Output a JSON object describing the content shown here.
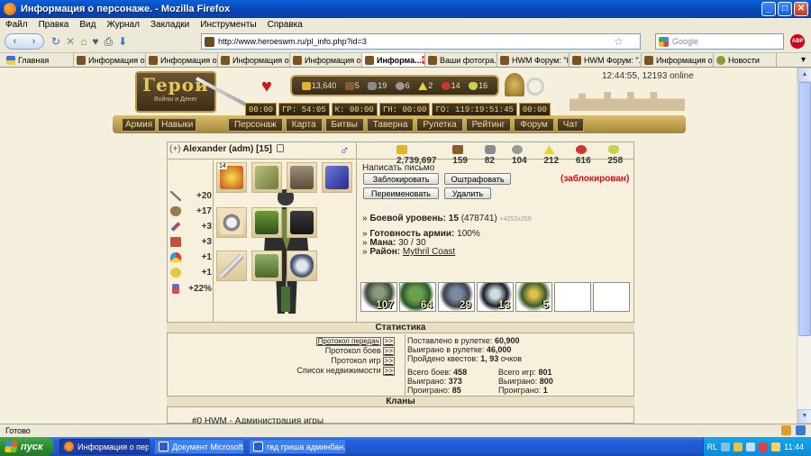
{
  "window": {
    "title": "Информация о персонаже. - Mozilla Firefox",
    "minimize": "_",
    "maximize": "□",
    "close": "✕"
  },
  "menu": [
    "Файл",
    "Правка",
    "Вид",
    "Журнал",
    "Закладки",
    "Инструменты",
    "Справка"
  ],
  "nav": {
    "back": "‹",
    "forward": "›",
    "reload": "↻",
    "stop": "✕",
    "home": "⌂",
    "url": "http://www.heroeswm.ru/pl_info.php?id=3",
    "search_placeholder": "Google",
    "abp": "ABP"
  },
  "tabs": [
    {
      "label": "Главная"
    },
    {
      "label": "Информация о ..."
    },
    {
      "label": "Информация о ..."
    },
    {
      "label": "Информация о ..."
    },
    {
      "label": "Информация о ..."
    },
    {
      "label": "Информа..."
    },
    {
      "label": "Ваши фотогра..."
    },
    {
      "label": "HWM Форум: \"I..."
    },
    {
      "label": "HWM Форум: \"..."
    },
    {
      "label": "Информация о ..."
    },
    {
      "label": "Новости"
    }
  ],
  "game": {
    "clock": "12:44:55, 12193 online",
    "logo_title": "Герои",
    "logo_sub": "Войны и Денег",
    "resources": {
      "gold": "13,640",
      "wood": "5",
      "ore": "19",
      "mercury": "6",
      "sulfur": "2",
      "crystal": "14",
      "gems": "16"
    },
    "timers": [
      "00:00",
      "ГР: 54:05",
      "К: 00:00",
      "ГН: 00:00",
      "ГО: 119:19:51:45",
      "00:00"
    ],
    "left_nav": [
      "Армия",
      "Навыки"
    ],
    "main_nav": [
      "Персонаж",
      "Карта",
      "Битвы",
      "Таверна",
      "Рулетка",
      "Рейтинг",
      "Форум",
      "Чат"
    ]
  },
  "player": {
    "plus": "(+)",
    "name": "Alexander (adm)",
    "level": "[15]",
    "gender_icon": "♂",
    "resources": {
      "gold": "2,739,697",
      "wood": "159",
      "ore": "82",
      "mercury": "104",
      "sulfur": "212",
      "crystal": "616",
      "gems": "258"
    },
    "stats": [
      {
        "name": "attack",
        "value": "+20"
      },
      {
        "name": "defense",
        "value": "+17"
      },
      {
        "name": "spellpower",
        "value": "+3"
      },
      {
        "name": "knowledge",
        "value": "+3"
      },
      {
        "name": "luck",
        "value": "+1"
      },
      {
        "name": "morale",
        "value": "+1"
      },
      {
        "name": "initiative",
        "value": "+22%"
      }
    ],
    "equip_level": "14",
    "write_letter": "Написать письмо",
    "buttons": {
      "block": "Заблокировать",
      "fine": "Оштрафовать",
      "rename": "Переименовать",
      "delete": "Удалить"
    },
    "blocked": "(заблокирован)",
    "combat_label": "Боевой уровень:",
    "combat_value": "15",
    "combat_exp": "(478741)",
    "combat_extra": "+4252±259",
    "army_label": "Готовность армии:",
    "army_value": "100%",
    "mana_label": "Мана:",
    "mana_value": "30 / 30",
    "district_label": "Район:",
    "district_value": "Mythril Coast",
    "army": [
      "107",
      "64",
      "29",
      "13",
      "5",
      "",
      ""
    ]
  },
  "stats_section": {
    "header": "Статистика",
    "links": [
      {
        "label": "Протокол передач",
        "btn": ">>"
      },
      {
        "label": "Протокол боев",
        "btn": ">>"
      },
      {
        "label": "Протокол игр",
        "btn": ">>"
      },
      {
        "label": "Список недвижимости",
        "btn": ">>"
      }
    ],
    "roulette_bet": "Поставлено в рулетке:",
    "roulette_bet_v": "60,900",
    "roulette_win": "Выиграно в рулетке:",
    "roulette_win_v": "46,000",
    "quests": "Пройдено квестов:",
    "quests_v": "1, 93",
    "quests_unit": "очков",
    "battles_total": "Всего боев:",
    "battles_total_v": "458",
    "battles_won": "Выиграно:",
    "battles_won_v": "373",
    "battles_lost": "Проиграно:",
    "battles_lost_v": "85",
    "games_total": "Всего игр:",
    "games_total_v": "801",
    "games_won": "Выиграно:",
    "games_won_v": "800",
    "games_lost": "Проиграно:",
    "games_lost_v": "1"
  },
  "clans": {
    "header": "Кланы",
    "entry": "#0 HWM - Администрация игры"
  },
  "statusbar": {
    "text": "Готово"
  },
  "taskbar": {
    "start": "пуск",
    "tasks": [
      "Информация о персо...",
      "Документ Microsoft ...",
      "гвд гриша админбан..."
    ],
    "lang": "RL",
    "time": "11:44"
  },
  "colors": {
    "blocked": "#c2141c",
    "accent_gold": "#c6a458"
  }
}
